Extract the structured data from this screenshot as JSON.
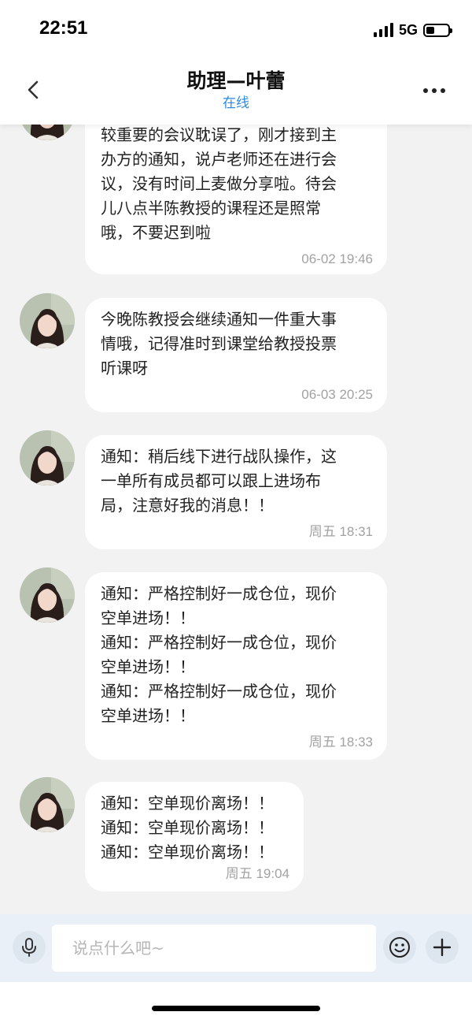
{
  "status_bar": {
    "time": "22:51",
    "network": "5G",
    "battery_level": 0.4
  },
  "header": {
    "title": "助理—叶蕾",
    "status": "在线",
    "back_icon": "chevron-left-icon",
    "more_icon": "more-horizontal-icon"
  },
  "messages": [
    {
      "text": "较重要的会议耽误了，刚才接到主\n办方的通知，说卢老师还在进行会\n议，没有时间上麦做分享啦。待会\n儿八点半陈教授的课程还是照常\n哦，不要迟到啦",
      "time": "06-02 19:46"
    },
    {
      "text": "今晚陈教授会继续通知一件重大事\n情哦，记得准时到课堂给教授投票\n听课呀",
      "time": "06-03 20:25"
    },
    {
      "text": "通知：稍后线下进行战队操作，这\n一单所有成员都可以跟上进场布\n局，注意好我的消息！！",
      "time": "周五 18:31"
    },
    {
      "text": "通知：严格控制好一成仓位，现价\n空单进场！！\n通知：严格控制好一成仓位，现价\n空单进场！！\n通知：严格控制好一成仓位，现价\n空单进场！！",
      "time": "周五 18:33"
    },
    {
      "text": "通知：空单现价离场！！\n通知：空单现价离场！！\n通知：空单现价离场！！",
      "time": "周五 19:04"
    }
  ],
  "input": {
    "placeholder": "说点什么吧~",
    "value": ""
  },
  "icons": {
    "mic": "microphone-icon",
    "emoji": "smiley-icon",
    "plus": "plus-icon"
  },
  "colors": {
    "accent": "#2b8be6",
    "bubble": "#ffffff",
    "background": "#f2f2f2",
    "input_bar": "#e9f0f7"
  }
}
